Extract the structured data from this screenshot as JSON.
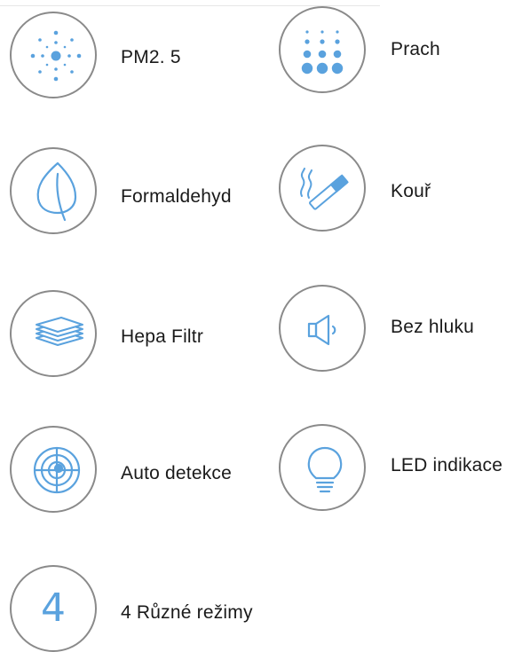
{
  "features": [
    {
      "label": "PM2. 5",
      "icon": "particles-radial-icon"
    },
    {
      "label": "Prach",
      "icon": "dust-dots-icon"
    },
    {
      "label": "Formaldehyd",
      "icon": "leaf-icon"
    },
    {
      "label": "Kouř",
      "icon": "cigarette-smoke-icon"
    },
    {
      "label": "Hepa Filtr",
      "icon": "filter-layers-icon"
    },
    {
      "label": "Bez hluku",
      "icon": "speaker-quiet-icon"
    },
    {
      "label": "Auto detekce",
      "icon": "target-sensor-icon"
    },
    {
      "label": "LED indikace",
      "icon": "light-bulb-icon"
    },
    {
      "label": "4 Různé režimy",
      "icon": "number-four-icon",
      "icon_text": "4"
    }
  ],
  "colors": {
    "icon_blue": "#5aa2de",
    "circle_border": "#8a8a8a",
    "text": "#1a1a1a"
  }
}
